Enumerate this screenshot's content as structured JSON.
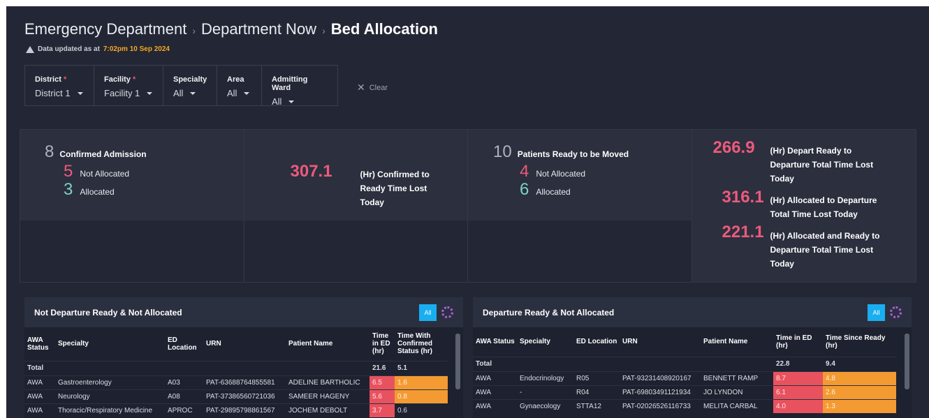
{
  "breadcrumb": [
    "Emergency Department",
    "Department Now",
    "Bed Allocation"
  ],
  "updated": {
    "prefix": "Data updated as at",
    "time": "7:02pm 10 Sep 2024"
  },
  "filters": [
    {
      "label": "District",
      "required": "*",
      "value": "District 1"
    },
    {
      "label": "Facility",
      "required": "*",
      "value": "Facility 1"
    },
    {
      "label": "Specialty",
      "required": "",
      "value": "All"
    },
    {
      "label": "Area",
      "required": "",
      "value": "All"
    },
    {
      "label": "Admitting Ward",
      "required": "",
      "value": "All"
    }
  ],
  "clear_label": "Clear",
  "kpis": {
    "confirmed": {
      "value": "8",
      "label": "Confirmed Admission",
      "not_allocated": "5",
      "not_allocated_label": "Not Allocated",
      "allocated": "3",
      "allocated_label": "Allocated"
    },
    "confirmed_time": {
      "value": "307.1",
      "label": "(Hr) Confirmed to Ready Time Lost Today"
    },
    "ready": {
      "value": "10",
      "label": "Patients Ready to be Moved",
      "not_allocated": "4",
      "not_allocated_label": "Not Allocated",
      "allocated": "6",
      "allocated_label": "Allocated"
    },
    "lost": [
      {
        "value": "266.9",
        "label": "(Hr) Depart Ready to Departure Total Time Lost Today"
      },
      {
        "value": "316.1",
        "label": "(Hr) Allocated to Departure Total Time Lost Today"
      },
      {
        "value": "221.1",
        "label": "(Hr) Allocated and Ready to Departure Total Time Lost Today"
      }
    ]
  },
  "left_panel": {
    "title": "Not Departure Ready & Not Allocated",
    "all_label": "All",
    "headers": [
      "AWA Status",
      "Specialty",
      "ED Location",
      "URN",
      "Patient Name",
      "Time in ED (hr)",
      "Time With Confirmed Status (hr)"
    ],
    "total": {
      "label": "Total",
      "time_ed": "21.6",
      "time2": "5.1"
    },
    "rows": [
      {
        "status": "AWA",
        "specialty": "Gastroenterology",
        "location": "A03",
        "urn": "PAT-63688764855581",
        "name": "ADELINE BARTHOLIC",
        "time_ed": "6.5",
        "time2": "1.6"
      },
      {
        "status": "AWA",
        "specialty": "Neurology",
        "location": "A08",
        "urn": "PAT-37386560721036",
        "name": "SAMEER HAGENY",
        "time_ed": "5.6",
        "time2": "0.8"
      },
      {
        "status": "AWA",
        "specialty": "Thoracic/Respiratory Medicine",
        "location": "APROC",
        "urn": "PAT-29895798861567",
        "name": "JOCHEM DEBOLT",
        "time_ed": "3.7",
        "time2": "0.6"
      }
    ]
  },
  "right_panel": {
    "title": "Departure Ready & Not Allocated",
    "all_label": "All",
    "headers": [
      "AWA Status",
      "Specialty",
      "ED Location",
      "URN",
      "Patient Name",
      "Time in ED (hr)",
      "Time Since Ready (hr)"
    ],
    "total": {
      "label": "Total",
      "time_ed": "22.8",
      "time2": "9.4"
    },
    "rows": [
      {
        "status": "AWA",
        "specialty": "Endocrinology",
        "location": "R05",
        "urn": "PAT-93231408920167",
        "name": "BENNETT RAMP",
        "time_ed": "8.7",
        "time2": "4.8"
      },
      {
        "status": "AWA",
        "specialty": "-",
        "location": "R04",
        "urn": "PAT-69803491121934",
        "name": "JO LYNDON",
        "time_ed": "6.1",
        "time2": "2.6"
      },
      {
        "status": "AWA",
        "specialty": "Gynaecology",
        "location": "STTA12",
        "urn": "PAT-02026526116733",
        "name": "MELITA CARBAL",
        "time_ed": "4.0",
        "time2": "1.3"
      }
    ]
  },
  "colors": {
    "background": "#232735",
    "accent_pink": "#ec5a7b",
    "accent_teal": "#7fd0c5",
    "warn_orange": "#f5a623",
    "cell_red": "#e8525f",
    "cell_orange": "#f39a32",
    "button_blue": "#19aef0"
  }
}
